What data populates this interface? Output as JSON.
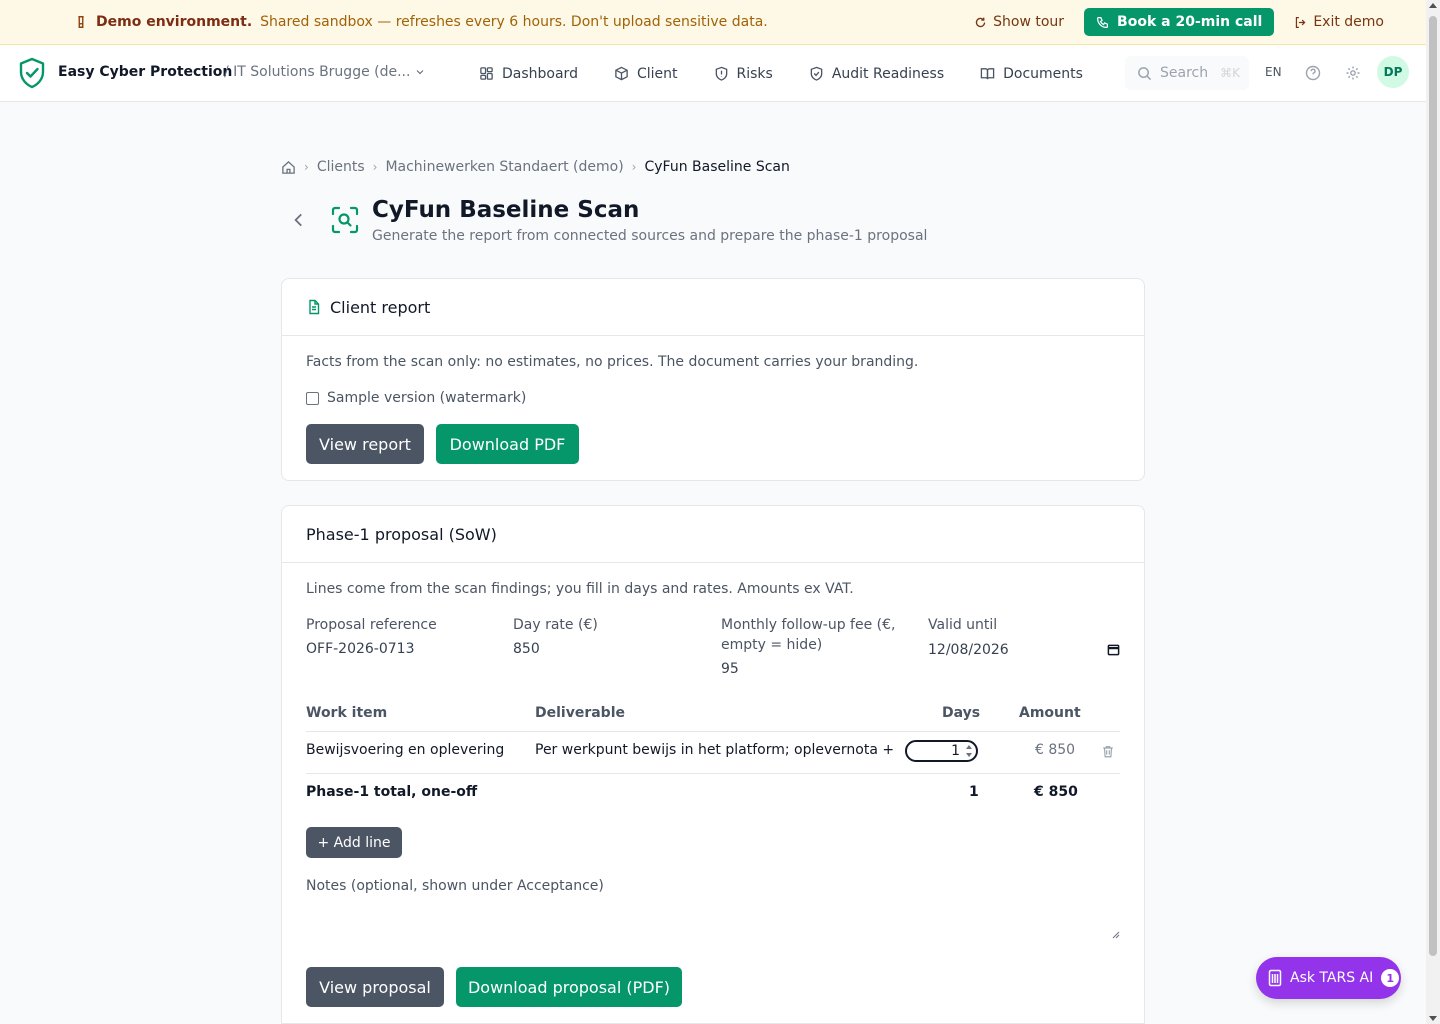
{
  "banner": {
    "title": "Demo environment.",
    "text": "Shared sandbox — refreshes every 6 hours. Don't upload sensitive data.",
    "show_tour": "Show tour",
    "book_call": "Book a 20-min call",
    "exit_demo": "Exit demo"
  },
  "nav": {
    "app_name": "Easy Cyber Protection",
    "tenant": "/ IT Solutions Brugge (de...",
    "items": [
      "Dashboard",
      "Client",
      "Risks",
      "Audit Readiness",
      "Documents"
    ],
    "search_placeholder": "Search",
    "search_shortcut": "⌘K",
    "language": "EN",
    "avatar_initials": "DP"
  },
  "breadcrumb": {
    "items": [
      "Clients",
      "Machinewerken Standaert (demo)"
    ],
    "current": "CyFun Baseline Scan"
  },
  "page": {
    "title": "CyFun Baseline Scan",
    "subtitle": "Generate the report from connected sources and prepare the phase-1 proposal"
  },
  "report_card": {
    "title": "Client report",
    "description": "Facts from the scan only: no estimates, no prices. The document carries your branding.",
    "checkbox_label": "Sample version (watermark)",
    "checkbox_checked": false,
    "view_button": "View report",
    "download_button": "Download PDF"
  },
  "proposal_card": {
    "title": "Phase-1 proposal (SoW)",
    "description": "Lines come from the scan findings; you fill in days and rates. Amounts ex VAT.",
    "fields": {
      "reference_label": "Proposal reference",
      "reference_value": "OFF-2026-0713",
      "day_rate_label": "Day rate (€)",
      "day_rate_value": "850",
      "monthly_fee_label": "Monthly follow-up fee (€, empty = hide)",
      "monthly_fee_value": "95",
      "valid_until_label": "Valid until",
      "valid_until_value": "12/08/2026"
    },
    "table": {
      "headers": [
        "Work item",
        "Deliverable",
        "Days",
        "Amount"
      ],
      "rows": [
        {
          "work_item": "Bewijsvoering en oplevering",
          "deliverable": "Per werkpunt bewijs in het platform; oplevernota + bijge",
          "days": "1",
          "amount": "€ 850"
        }
      ],
      "total_label": "Phase-1 total, one-off",
      "total_days": "1",
      "total_amount": "€ 850"
    },
    "add_line": "+ Add line",
    "notes_label": "Notes (optional, shown under Acceptance)",
    "view_button": "View proposal",
    "download_button": "Download proposal (PDF)"
  },
  "assistant": {
    "label": "Ask TARS AI",
    "badge": "1"
  },
  "colors": {
    "accent": "#059669",
    "banner_bg": "#fef9e7",
    "dark_button": "#4b5563",
    "assistant": "#9333ea"
  }
}
